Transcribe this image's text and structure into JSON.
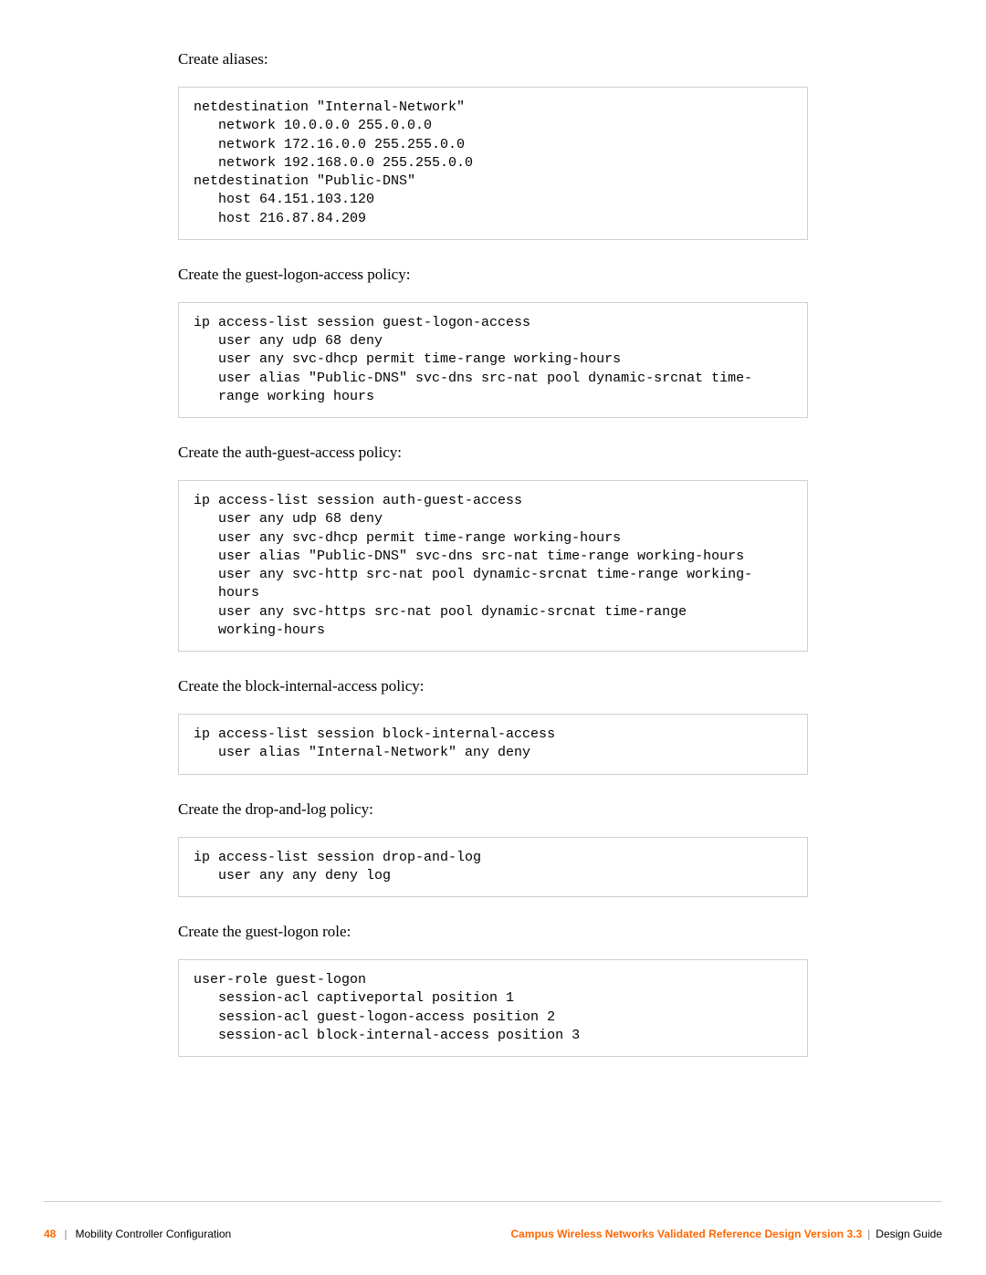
{
  "sections": [
    {
      "label": "Create aliases:",
      "code": "netdestination \"Internal-Network\"\n   network 10.0.0.0 255.0.0.0\n   network 172.16.0.0 255.255.0.0\n   network 192.168.0.0 255.255.0.0\nnetdestination \"Public-DNS\"\n   host 64.151.103.120\n   host 216.87.84.209"
    },
    {
      "label": "Create the guest-logon-access policy:",
      "code": "ip access-list session guest-logon-access\n   user any udp 68 deny\n   user any svc-dhcp permit time-range working-hours\n   user alias \"Public-DNS\" svc-dns src-nat pool dynamic-srcnat time-\n   range working hours"
    },
    {
      "label": "Create the auth-guest-access policy:",
      "code": "ip access-list session auth-guest-access\n   user any udp 68 deny\n   user any svc-dhcp permit time-range working-hours\n   user alias \"Public-DNS\" svc-dns src-nat time-range working-hours\n   user any svc-http src-nat pool dynamic-srcnat time-range working-\n   hours\n   user any svc-https src-nat pool dynamic-srcnat time-range\n   working-hours"
    },
    {
      "label": "Create the block-internal-access policy:",
      "code": "ip access-list session block-internal-access\n   user alias \"Internal-Network\" any deny"
    },
    {
      "label": "Create the drop-and-log policy:",
      "code": "ip access-list session drop-and-log\n   user any any deny log"
    },
    {
      "label": "Create the guest-logon role:",
      "code": "user-role guest-logon\n   session-acl captiveportal position 1\n   session-acl guest-logon-access position 2\n   session-acl block-internal-access position 3"
    }
  ],
  "footer": {
    "page_num": "48",
    "sep": "|",
    "chapter": "Mobility Controller Configuration",
    "doc_title": "Campus Wireless Networks Validated Reference Design Version 3.3",
    "design_guide": "Design Guide"
  }
}
